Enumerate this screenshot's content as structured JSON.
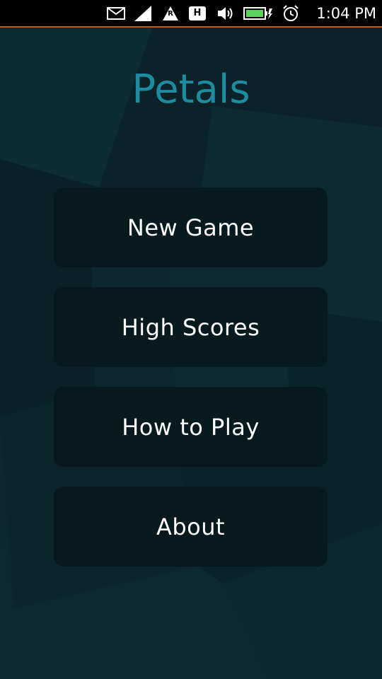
{
  "status_bar": {
    "time": "1:04 PM",
    "icons": [
      "mail-icon",
      "signal-icon",
      "roaming-icon",
      "hspa-icon",
      "volume-icon",
      "battery-charging-icon",
      "alarm-icon"
    ],
    "roaming_letter": "R",
    "network_letter": "H"
  },
  "app": {
    "title": "Petals"
  },
  "menu": {
    "new_game": "New Game",
    "high_scores": "High Scores",
    "how_to_play": "How to Play",
    "about": "About"
  },
  "colors": {
    "title": "#1e8ca0",
    "background": "#0c272d",
    "button": "#06171a",
    "status_accent": "#c0581f"
  }
}
